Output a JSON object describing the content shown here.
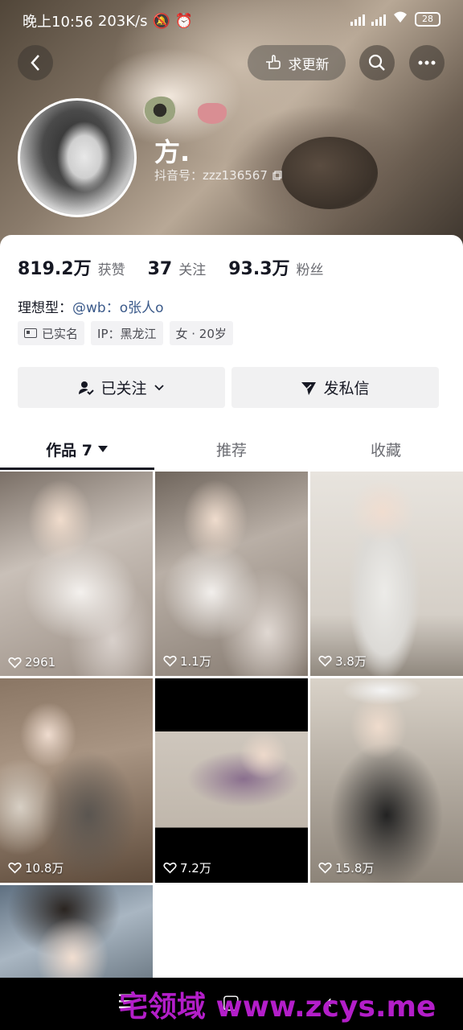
{
  "statusbar": {
    "time": "晚上10:56",
    "speed": "203K/s",
    "battery": "28"
  },
  "topnav": {
    "update_label": "求更新"
  },
  "profile": {
    "name": "方.",
    "douyin_id": "抖音号：zzz136567"
  },
  "stats": [
    {
      "value": "819.2万",
      "label": "获赞"
    },
    {
      "value": "37",
      "label": "关注"
    },
    {
      "value": "93.3万",
      "label": "粉丝"
    }
  ],
  "bio": {
    "prefix": "理想型：",
    "link": "@wb：o张人o"
  },
  "tags": [
    {
      "text": "已实名",
      "icon": "id-card-icon"
    },
    {
      "text": "IP：黑龙江",
      "icon": ""
    },
    {
      "text": "女 · 20岁",
      "icon": ""
    }
  ],
  "actions": {
    "follow_label": "已关注",
    "message_label": "发私信"
  },
  "tabs": [
    {
      "label": "作品 7"
    },
    {
      "label": "推荐"
    },
    {
      "label": "收藏"
    }
  ],
  "videos": [
    {
      "likes": "2961"
    },
    {
      "likes": "1.1万"
    },
    {
      "likes": "3.8万"
    },
    {
      "likes": "10.8万"
    },
    {
      "likes": "7.2万"
    },
    {
      "likes": "15.8万"
    },
    {
      "likes": ""
    }
  ],
  "watermark": "宅领域 www.zcys.me",
  "colors": {
    "link": "#3b5a8a",
    "text_primary": "#161823",
    "text_secondary": "#6b6c72",
    "button_bg": "#f1f1f2",
    "watermark": "#b31ec9"
  }
}
